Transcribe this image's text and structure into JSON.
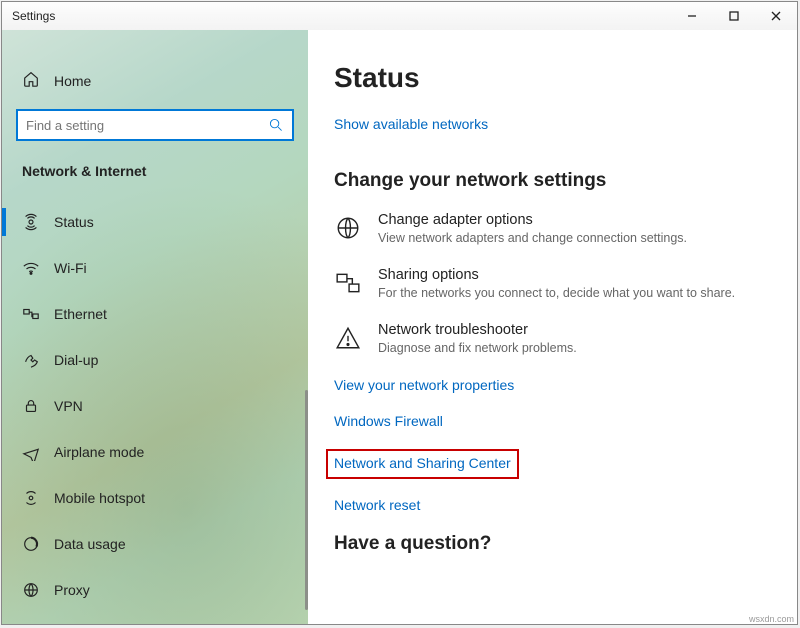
{
  "window": {
    "title": "Settings"
  },
  "sidebar": {
    "home": "Home",
    "search_placeholder": "Find a setting",
    "category": "Network & Internet",
    "items": [
      {
        "label": "Status"
      },
      {
        "label": "Wi-Fi"
      },
      {
        "label": "Ethernet"
      },
      {
        "label": "Dial-up"
      },
      {
        "label": "VPN"
      },
      {
        "label": "Airplane mode"
      },
      {
        "label": "Mobile hotspot"
      },
      {
        "label": "Data usage"
      },
      {
        "label": "Proxy"
      }
    ]
  },
  "main": {
    "heading": "Status",
    "show_networks": "Show available networks",
    "change_heading": "Change your network settings",
    "adapter_title": "Change adapter options",
    "adapter_desc": "View network adapters and change connection settings.",
    "sharing_title": "Sharing options",
    "sharing_desc": "For the networks you connect to, decide what you want to share.",
    "trouble_title": "Network troubleshooter",
    "trouble_desc": "Diagnose and fix network problems.",
    "link_properties": "View your network properties",
    "link_firewall": "Windows Firewall",
    "link_sharing_center": "Network and Sharing Center",
    "link_reset": "Network reset",
    "question_heading": "Have a question?"
  },
  "watermark": "wsxdn.com"
}
